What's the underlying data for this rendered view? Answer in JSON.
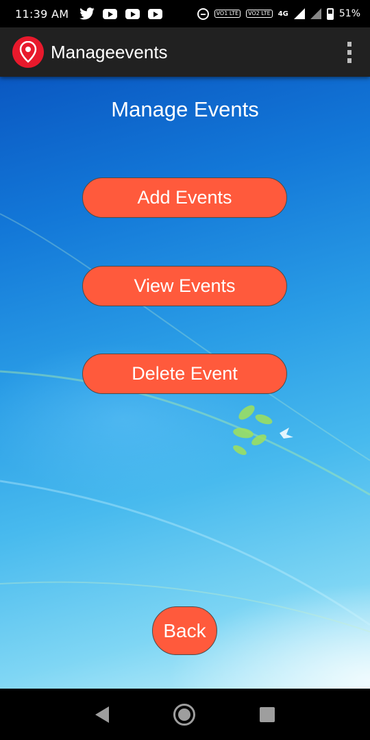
{
  "status_bar": {
    "time": "11:39 AM",
    "battery": "51%",
    "network": "4G",
    "sim1": "VO1 LTE",
    "sim2": "VO2 LTE",
    "notification_icons": [
      "twitter-icon",
      "youtube-icon",
      "youtube-icon",
      "youtube-icon"
    ]
  },
  "app_bar": {
    "title": "Manageevents",
    "logo_icon": "location-pin-icon",
    "menu_icon": "overflow-menu-icon",
    "color": "#212121",
    "logo_color": "#e8192c"
  },
  "main": {
    "title": "Manage Events",
    "buttons": {
      "add": "Add Events",
      "view": "View Events",
      "delete": "Delete Event",
      "back": "Back"
    },
    "button_color": "#ff5a3c"
  },
  "nav_bar": {
    "icons": [
      "back-triangle-icon",
      "home-circle-icon",
      "recents-square-icon"
    ]
  }
}
